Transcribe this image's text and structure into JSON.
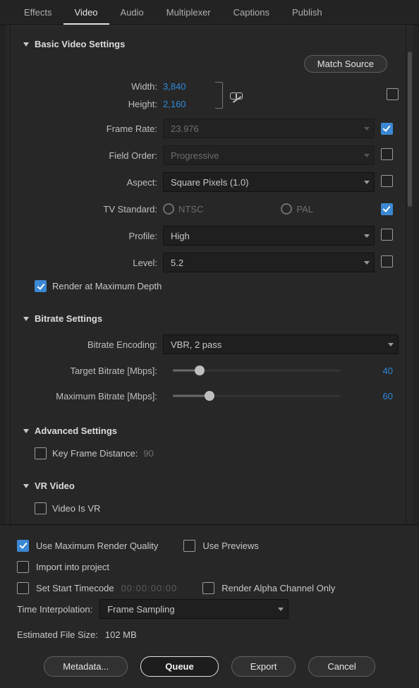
{
  "tabs": [
    "Effects",
    "Video",
    "Audio",
    "Multiplexer",
    "Captions",
    "Publish"
  ],
  "active_tab": 1,
  "basic": {
    "title": "Basic Video Settings",
    "match_source": "Match Source",
    "width_label": "Width:",
    "width_value": "3,840",
    "height_label": "Height:",
    "height_value": "2,160",
    "frame_rate_label": "Frame Rate:",
    "frame_rate_value": "23.976",
    "frame_rate_checked": true,
    "field_order_label": "Field Order:",
    "field_order_value": "Progressive",
    "field_order_checked": false,
    "aspect_label": "Aspect:",
    "aspect_value": "Square Pixels (1.0)",
    "aspect_checked": false,
    "tv_label": "TV Standard:",
    "tv_ntsc": "NTSC",
    "tv_pal": "PAL",
    "tv_checked": true,
    "profile_label": "Profile:",
    "profile_value": "High",
    "profile_checked": false,
    "level_label": "Level:",
    "level_value": "5.2",
    "level_checked": false,
    "render_max_label": "Render at Maximum Depth",
    "render_max_checked": true
  },
  "bitrate": {
    "title": "Bitrate Settings",
    "enc_label": "Bitrate Encoding:",
    "enc_value": "VBR, 2 pass",
    "target_label": "Target Bitrate [Mbps]:",
    "target_value": "40",
    "target_pct": 16,
    "max_label": "Maximum Bitrate [Mbps]:",
    "max_value": "60",
    "max_pct": 22
  },
  "advanced": {
    "title": "Advanced Settings",
    "kfd_label": "Key Frame Distance:",
    "kfd_value": "90",
    "kfd_checked": false
  },
  "vr": {
    "title": "VR Video",
    "is_vr_label": "Video Is VR",
    "is_vr_checked": false
  },
  "bottom": {
    "maxq": "Use Maximum Render Quality",
    "maxq_checked": true,
    "previews": "Use Previews",
    "previews_checked": false,
    "import": "Import into project",
    "import_checked": false,
    "set_tc": "Set Start Timecode",
    "set_tc_checked": false,
    "tc_value": "00:00:00:00",
    "alpha": "Render Alpha Channel Only",
    "alpha_checked": false,
    "tinterp_label": "Time Interpolation:",
    "tinterp_value": "Frame Sampling",
    "est_label": "Estimated File Size:",
    "est_value": "102 MB",
    "metadata": "Metadata...",
    "queue": "Queue",
    "export": "Export",
    "cancel": "Cancel"
  }
}
